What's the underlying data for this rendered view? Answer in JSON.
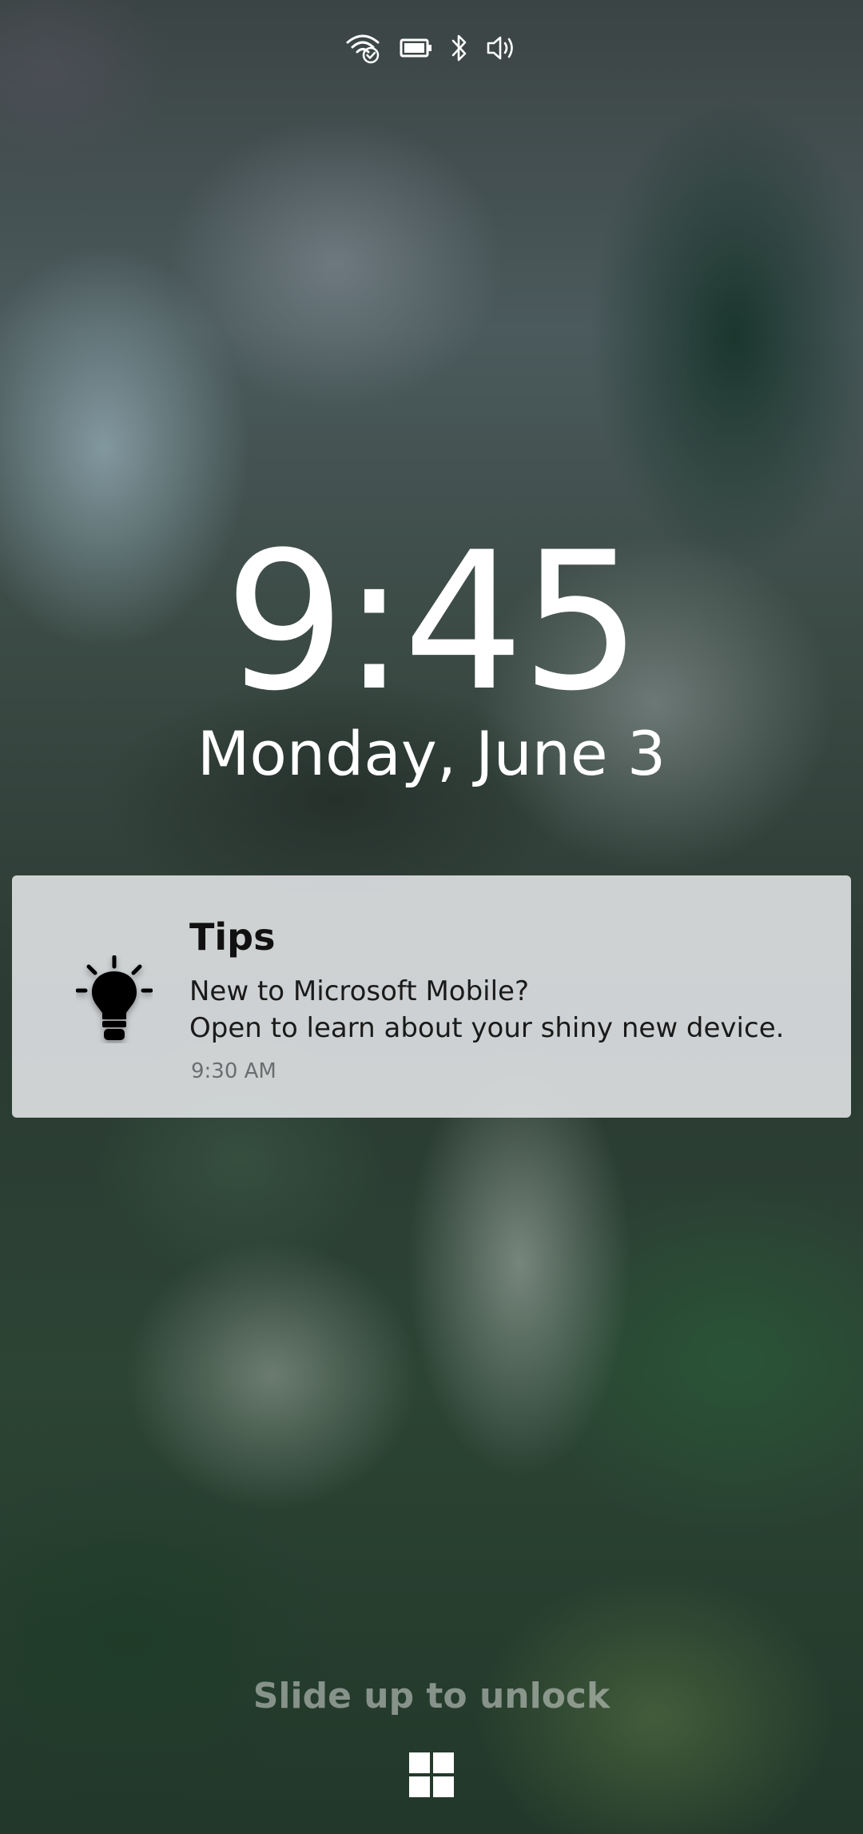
{
  "status_bar": {
    "icons": [
      "wifi-connected-icon",
      "battery-icon",
      "bluetooth-icon",
      "volume-icon"
    ],
    "color": "#ffffff"
  },
  "lock_screen": {
    "time": "9:45",
    "date": "Monday, June 3"
  },
  "notification": {
    "app_icon": "lightbulb-icon",
    "title": "Tips",
    "line1": "New to Microsoft Mobile?",
    "line2": "Open to learn about your shiny new device.",
    "time": "9:30 AM",
    "background": "#e0e2e4"
  },
  "unlock": {
    "hint": "Slide up to unlock",
    "button_icon": "windows-logo-icon"
  }
}
